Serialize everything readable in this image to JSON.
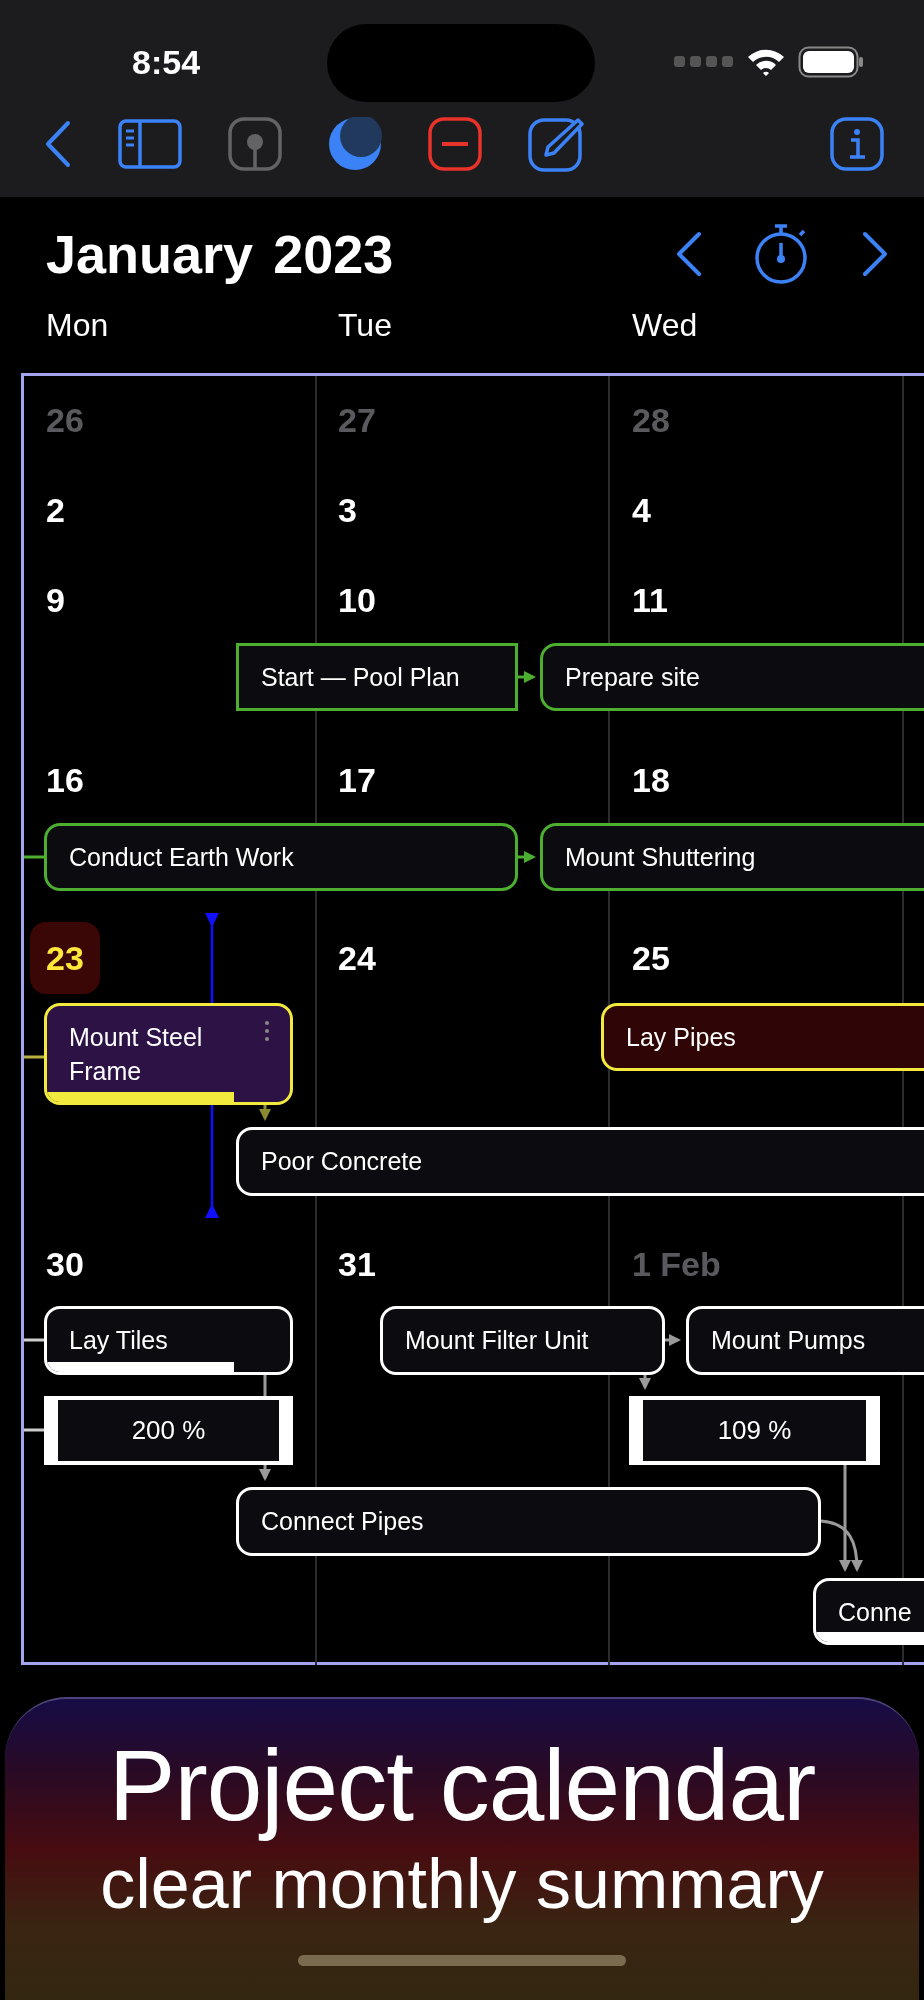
{
  "status_bar": {
    "time": "8:54"
  },
  "header": {
    "month": "January",
    "year": "2023"
  },
  "weekdays": [
    "Mon",
    "Tue",
    "Wed"
  ],
  "weeks": [
    {
      "days": [
        {
          "label": "26",
          "muted": true,
          "today": false
        },
        {
          "label": "27",
          "muted": true,
          "today": false
        },
        {
          "label": "28",
          "muted": true,
          "today": false
        }
      ]
    },
    {
      "days": [
        {
          "label": "2",
          "muted": false,
          "today": false
        },
        {
          "label": "3",
          "muted": false,
          "today": false
        },
        {
          "label": "4",
          "muted": false,
          "today": false
        }
      ]
    },
    {
      "days": [
        {
          "label": "9",
          "muted": false,
          "today": false
        },
        {
          "label": "10",
          "muted": false,
          "today": false
        },
        {
          "label": "11",
          "muted": false,
          "today": false
        }
      ]
    },
    {
      "days": [
        {
          "label": "16",
          "muted": false,
          "today": false
        },
        {
          "label": "17",
          "muted": false,
          "today": false
        },
        {
          "label": "18",
          "muted": false,
          "today": false
        }
      ]
    },
    {
      "days": [
        {
          "label": "23",
          "muted": false,
          "today": true
        },
        {
          "label": "24",
          "muted": false,
          "today": false
        },
        {
          "label": "25",
          "muted": false,
          "today": false
        }
      ]
    },
    {
      "days": [
        {
          "label": "30",
          "muted": false,
          "today": false
        },
        {
          "label": "31",
          "muted": false,
          "today": false
        },
        {
          "label": "1 Feb",
          "muted": true,
          "today": false
        }
      ]
    }
  ],
  "tasks": [
    {
      "title": "Start — Pool Plan",
      "kind": "summary",
      "color": "#4caf2f",
      "selected": false,
      "overdue": false
    },
    {
      "title": "Prepare site",
      "kind": "task",
      "color": "#4caf2f",
      "selected": false,
      "overdue": false
    },
    {
      "title": "Conduct Earth Work",
      "kind": "task",
      "color": "#4caf2f",
      "selected": false,
      "overdue": false
    },
    {
      "title": "Mount Shuttering",
      "kind": "task",
      "color": "#4caf2f",
      "selected": false,
      "overdue": false
    },
    {
      "title": "Mount Steel Frame",
      "kind": "task",
      "color": "#f2ea3c",
      "selected": true,
      "overdue": false,
      "level": 0.77
    },
    {
      "title": "Lay Pipes",
      "kind": "task",
      "color": "#f2ea3c",
      "selected": false,
      "overdue": true
    },
    {
      "title": "Poor Concrete",
      "kind": "task",
      "color": "#ffffff",
      "selected": false,
      "overdue": false
    },
    {
      "title": "Lay Tiles",
      "kind": "task",
      "color": "#ffffff",
      "selected": false,
      "overdue": false,
      "level": 0.77
    },
    {
      "title": "200 %",
      "kind": "load",
      "color": "#ffffff"
    },
    {
      "title": "Mount Filter Unit",
      "kind": "task",
      "color": "#ffffff",
      "selected": false,
      "overdue": false
    },
    {
      "title": "Mount Pumps",
      "kind": "task",
      "color": "#ffffff",
      "selected": false,
      "overdue": false
    },
    {
      "title": "109 %",
      "kind": "load",
      "color": "#ffffff"
    },
    {
      "title": "Connect Pipes",
      "kind": "task",
      "color": "#ffffff",
      "selected": false,
      "overdue": false
    },
    {
      "title": "Conne",
      "kind": "task",
      "color": "#ffffff",
      "selected": false,
      "overdue": false,
      "level": 1
    }
  ],
  "banner": {
    "title": "Project calendar",
    "subtitle": "clear monthly summary"
  }
}
